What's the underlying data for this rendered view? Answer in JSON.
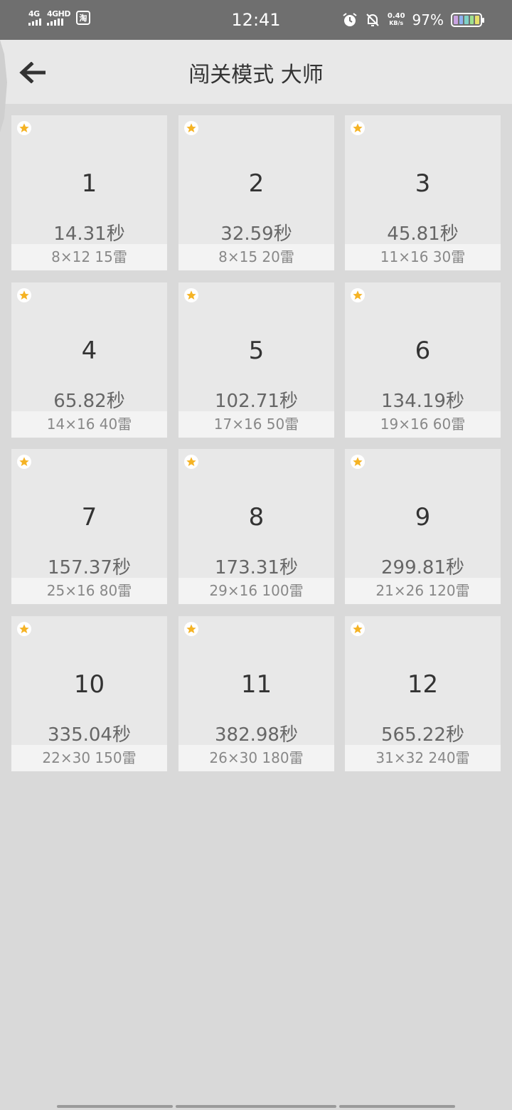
{
  "status_bar": {
    "net1": "4G",
    "net2": "4GHD",
    "taobao": "淘",
    "time": "12:41",
    "speed_value": "0.40",
    "speed_unit": "KB/s",
    "battery": "97%"
  },
  "header": {
    "title": "闯关模式 大师",
    "back_icon": "arrow-left-icon"
  },
  "levels": [
    {
      "number": "1",
      "time": "14.31秒",
      "info": "8×12  15雷"
    },
    {
      "number": "2",
      "time": "32.59秒",
      "info": "8×15  20雷"
    },
    {
      "number": "3",
      "time": "45.81秒",
      "info": "11×16  30雷"
    },
    {
      "number": "4",
      "time": "65.82秒",
      "info": "14×16  40雷"
    },
    {
      "number": "5",
      "time": "102.71秒",
      "info": "17×16  50雷"
    },
    {
      "number": "6",
      "time": "134.19秒",
      "info": "19×16  60雷"
    },
    {
      "number": "7",
      "time": "157.37秒",
      "info": "25×16  80雷"
    },
    {
      "number": "8",
      "time": "173.31秒",
      "info": "29×16  100雷"
    },
    {
      "number": "9",
      "time": "299.81秒",
      "info": "21×26  120雷"
    },
    {
      "number": "10",
      "time": "335.04秒",
      "info": "22×30  150雷"
    },
    {
      "number": "11",
      "time": "382.98秒",
      "info": "26×30  180雷"
    },
    {
      "number": "12",
      "time": "565.22秒",
      "info": "31×32  240雷"
    }
  ],
  "colors": {
    "star": "#f5b324",
    "status_bar": "#6f6f6f",
    "background": "#d9d9d9",
    "tile": "#e8e8e8"
  }
}
